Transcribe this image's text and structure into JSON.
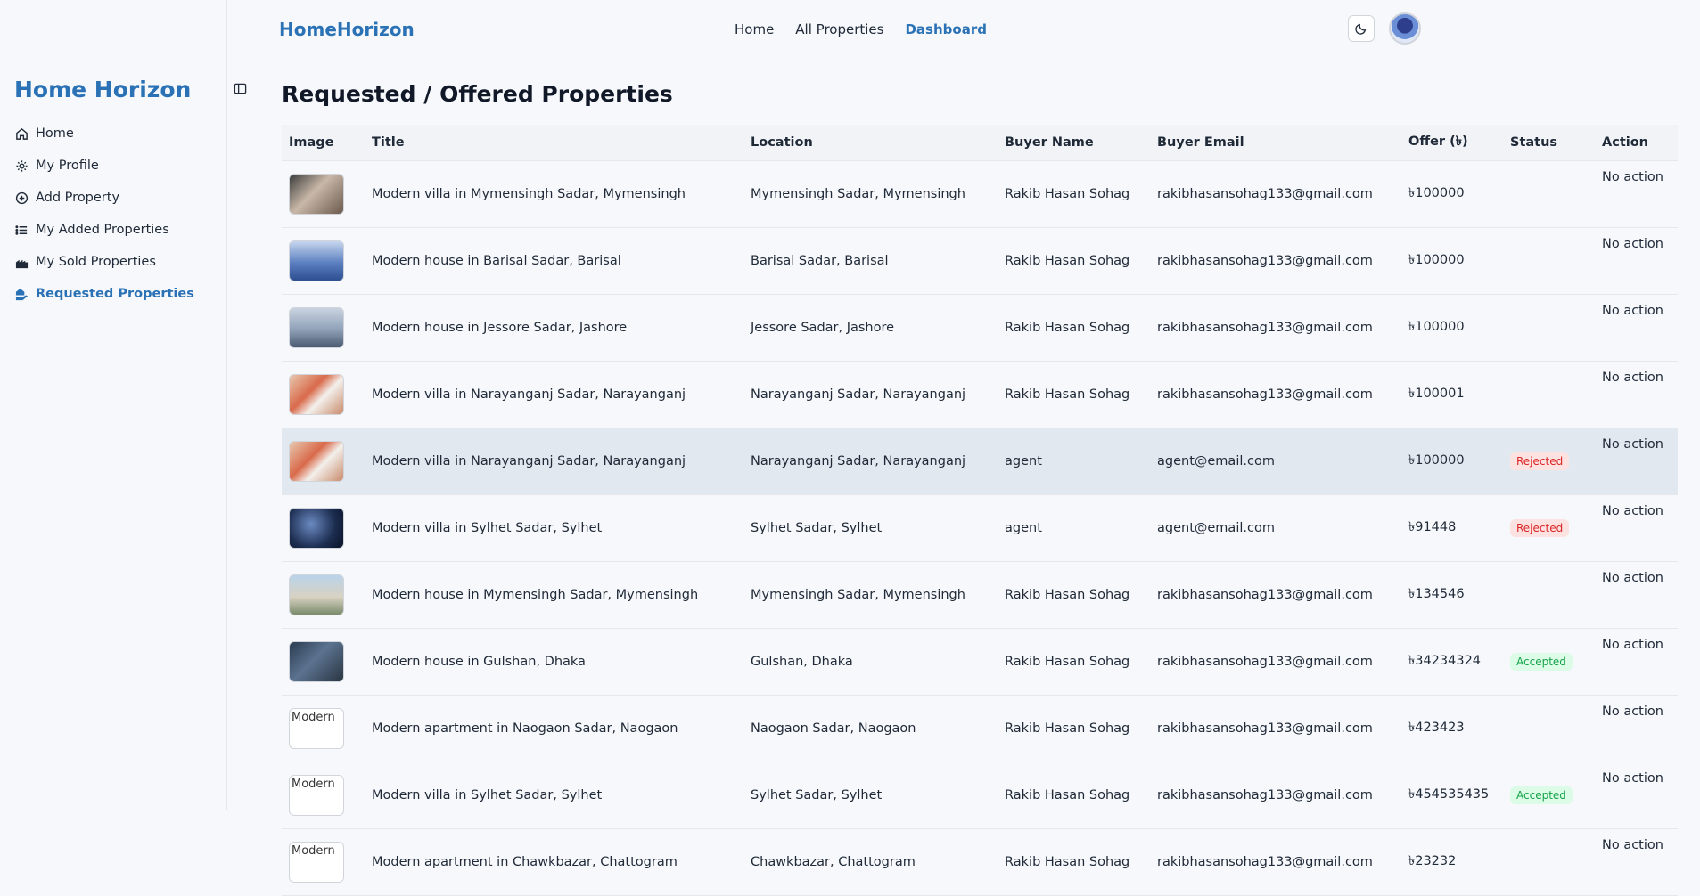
{
  "topbar": {
    "brand": "HomeHorizon",
    "nav": [
      {
        "label": "Home"
      },
      {
        "label": "All Properties"
      },
      {
        "label": "Dashboard"
      }
    ]
  },
  "sidebar": {
    "brand": "Home Horizon",
    "items": [
      {
        "label": "Home",
        "icon": "home-icon"
      },
      {
        "label": "My Profile",
        "icon": "gear-icon"
      },
      {
        "label": "Add Property",
        "icon": "plus-circle-icon"
      },
      {
        "label": "My Added Properties",
        "icon": "list-icon"
      },
      {
        "label": "My Sold Properties",
        "icon": "city-icon"
      },
      {
        "label": "Requested Properties",
        "icon": "hand-house-icon"
      }
    ]
  },
  "main": {
    "title": "Requested / Offered Properties",
    "columns": [
      "Image",
      "Title",
      "Location",
      "Buyer Name",
      "Buyer Email",
      "Offer (৳)",
      "Status",
      "Action"
    ],
    "rows": [
      {
        "img_alt": "",
        "title": "Modern villa in Mymensingh Sadar, Mymensingh",
        "location": "Mymensingh Sadar, Mymensingh",
        "buyer": "Rakib Hasan Sohag",
        "email": "rakibhasansohag133@gmail.com",
        "offer": "৳100000",
        "status": "",
        "action": "No action"
      },
      {
        "img_alt": "",
        "title": "Modern house in Barisal Sadar, Barisal",
        "location": "Barisal Sadar, Barisal",
        "buyer": "Rakib Hasan Sohag",
        "email": "rakibhasansohag133@gmail.com",
        "offer": "৳100000",
        "status": "",
        "action": "No action"
      },
      {
        "img_alt": "",
        "title": "Modern house in Jessore Sadar, Jashore",
        "location": "Jessore Sadar, Jashore",
        "buyer": "Rakib Hasan Sohag",
        "email": "rakibhasansohag133@gmail.com",
        "offer": "৳100000",
        "status": "",
        "action": "No action"
      },
      {
        "img_alt": "",
        "title": "Modern villa in Narayanganj Sadar, Narayanganj",
        "location": "Narayanganj Sadar, Narayanganj",
        "buyer": "Rakib Hasan Sohag",
        "email": "rakibhasansohag133@gmail.com",
        "offer": "৳100001",
        "status": "",
        "action": "No action"
      },
      {
        "img_alt": "",
        "title": "Modern villa in Narayanganj Sadar, Narayanganj",
        "location": "Narayanganj Sadar, Narayanganj",
        "buyer": "agent",
        "email": "agent@email.com",
        "offer": "৳100000",
        "status": "Rejected",
        "action": "No action"
      },
      {
        "img_alt": "",
        "title": "Modern villa in Sylhet Sadar, Sylhet",
        "location": "Sylhet Sadar, Sylhet",
        "buyer": "agent",
        "email": "agent@email.com",
        "offer": "৳91448",
        "status": "Rejected",
        "action": "No action"
      },
      {
        "img_alt": "",
        "title": "Modern house in Mymensingh Sadar, Mymensingh",
        "location": "Mymensingh Sadar, Mymensingh",
        "buyer": "Rakib Hasan Sohag",
        "email": "rakibhasansohag133@gmail.com",
        "offer": "৳134546",
        "status": "",
        "action": "No action"
      },
      {
        "img_alt": "",
        "title": "Modern house in Gulshan, Dhaka",
        "location": "Gulshan, Dhaka",
        "buyer": "Rakib Hasan Sohag",
        "email": "rakibhasansohag133@gmail.com",
        "offer": "৳34234324",
        "status": "Accepted",
        "action": "No action"
      },
      {
        "img_alt": "Modern",
        "title": "Modern apartment in Naogaon Sadar, Naogaon",
        "location": "Naogaon Sadar, Naogaon",
        "buyer": "Rakib Hasan Sohag",
        "email": "rakibhasansohag133@gmail.com",
        "offer": "৳423423",
        "status": "",
        "action": "No action"
      },
      {
        "img_alt": "Modern",
        "title": "Modern villa in Sylhet Sadar, Sylhet",
        "location": "Sylhet Sadar, Sylhet",
        "buyer": "Rakib Hasan Sohag",
        "email": "rakibhasansohag133@gmail.com",
        "offer": "৳454535435",
        "status": "Accepted",
        "action": "No action"
      },
      {
        "img_alt": "Modern",
        "title": "Modern apartment in Chawkbazar, Chattogram",
        "location": "Chawkbazar, Chattogram",
        "buyer": "Rakib Hasan Sohag",
        "email": "rakibhasansohag133@gmail.com",
        "offer": "৳23232",
        "status": "",
        "action": "No action"
      }
    ]
  }
}
